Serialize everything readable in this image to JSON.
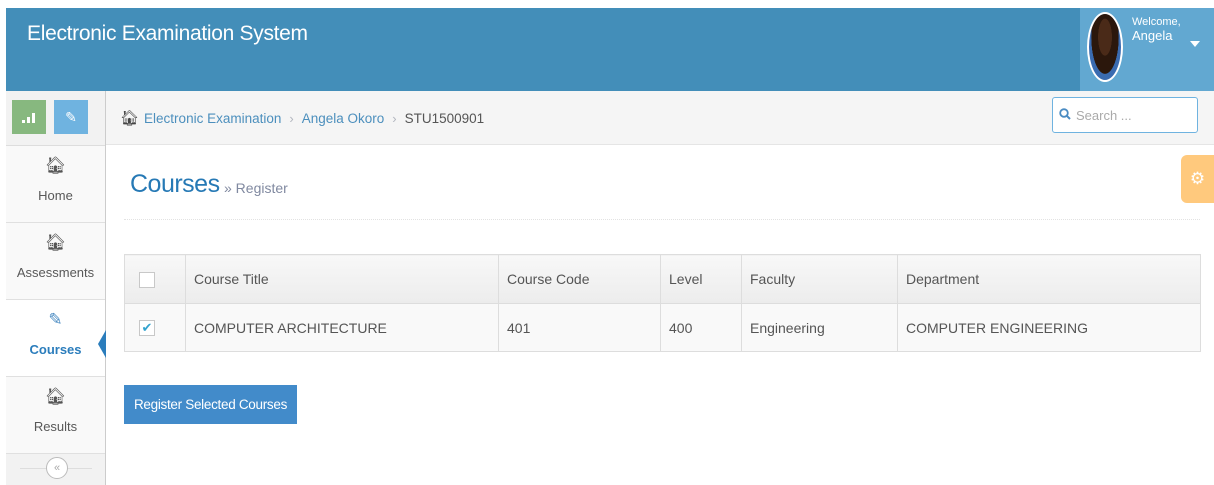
{
  "app": {
    "title": "Electronic Examination System"
  },
  "user": {
    "welcome": "Welcome,",
    "name": "Angela"
  },
  "breadcrumb": {
    "items": [
      "Electronic Examination",
      "Angela Okoro",
      "STU1500901"
    ]
  },
  "search": {
    "placeholder": "Search ..."
  },
  "sidebar": {
    "items": [
      {
        "label": "Home",
        "icon": "home-icon"
      },
      {
        "label": "Assessments",
        "icon": "home-icon"
      },
      {
        "label": "Courses",
        "icon": "edit-icon",
        "active": true
      },
      {
        "label": "Results",
        "icon": "home-icon"
      }
    ]
  },
  "page": {
    "title": "Courses",
    "subtitle": "» Register"
  },
  "table": {
    "headers": [
      "Course Title",
      "Course Code",
      "Level",
      "Faculty",
      "Department"
    ],
    "rows": [
      {
        "checked": true,
        "cells": [
          "COMPUTER ARCHITECTURE",
          "401",
          "400",
          "Engineering",
          "COMPUTER ENGINEERING"
        ]
      }
    ]
  },
  "actions": {
    "register_label": "Register Selected Courses"
  },
  "colors": {
    "navbar": "#438eb9",
    "user_area": "#62a8d1",
    "accent": "#2679b5",
    "button": "#428bca",
    "settings": "#ffb752"
  }
}
